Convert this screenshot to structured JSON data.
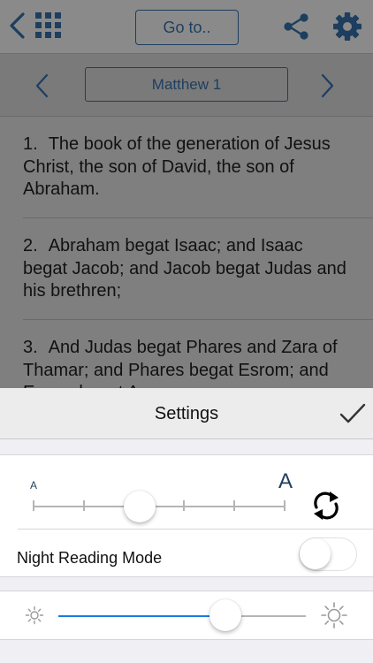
{
  "toolbar": {
    "back_icon": "chevron-left-icon",
    "grid_icon": "grid-icon",
    "goto_label": "Go to..",
    "share_icon": "share-icon",
    "settings_icon": "gear-icon",
    "accent_color": "#1e3e5f"
  },
  "chapter_nav": {
    "chapter_label": "Matthew 1"
  },
  "verses": [
    {
      "number": "1.",
      "text": "The book of the generation of Jesus Christ, the son of David, the son of Abraham."
    },
    {
      "number": "2.",
      "text": "Abraham begat Isaac; and Isaac begat Jacob; and Jacob begat Judas and his brethren;"
    },
    {
      "number": "3.",
      "text": "And Judas begat Phares and Zara of Thamar; and Phares begat Esrom; and Esrom begat Aram;"
    }
  ],
  "settings": {
    "title": "Settings",
    "font_size": {
      "small_label": "A",
      "large_label": "A",
      "steps": 6,
      "selected_step": 3
    },
    "night_mode": {
      "label": "Night Reading Mode",
      "enabled": false
    },
    "brightness": {
      "level": 0.675,
      "fill_color": "#1a7ae8"
    }
  }
}
